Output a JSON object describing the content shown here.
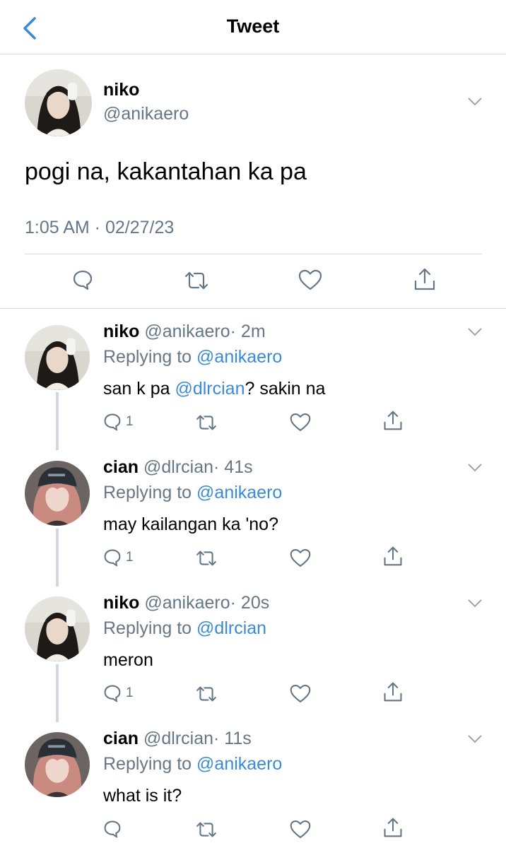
{
  "header": {
    "title": "Tweet"
  },
  "colors": {
    "accent": "#3a8ad7",
    "muted": "#657786",
    "divider": "#d9d9d9"
  },
  "main_tweet": {
    "name": "niko",
    "handle": "@anikaero",
    "text": "pogi na, kakantahan ka pa",
    "timestamp": "1:05 AM · 02/27/23",
    "avatar": "avatar-niko"
  },
  "replies": [
    {
      "name": "niko",
      "handle": "@anikaero",
      "time": "· 2m",
      "replying_label": "Replying to",
      "replying_to": "@anikaero",
      "text_before": "san k pa",
      "mention": "@dlrcian",
      "text_after": "? sakin na",
      "reply_count": "1",
      "avatar": "avatar-niko"
    },
    {
      "name": "cian",
      "handle": "@dlrcian",
      "time": "· 41s",
      "replying_label": "Replying to",
      "replying_to": "@anikaero",
      "text": "may kailangan ka 'no?",
      "reply_count": "1",
      "avatar": "avatar-cian"
    },
    {
      "name": "niko",
      "handle": "@anikaero",
      "time": "· 20s",
      "replying_label": "Replying to",
      "replying_to": "@dlrcian",
      "text": "meron",
      "reply_count": "1",
      "avatar": "avatar-niko"
    },
    {
      "name": "cian",
      "handle": "@dlrcian",
      "time": "· 11s",
      "replying_label": "Replying to",
      "replying_to": "@anikaero",
      "text": "what is it?",
      "reply_count": "",
      "avatar": "avatar-cian"
    }
  ]
}
